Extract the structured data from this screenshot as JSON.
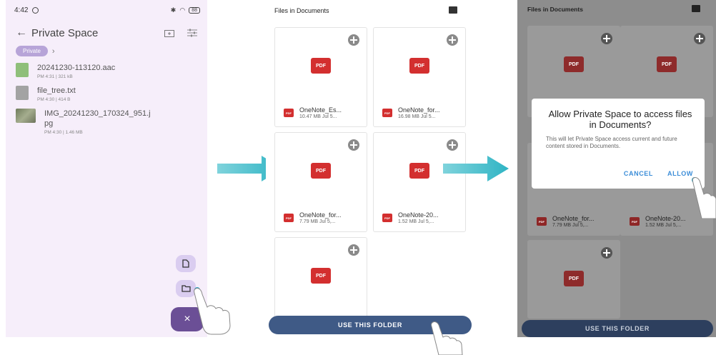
{
  "panel1": {
    "status": {
      "time": "4:42",
      "battery": "88"
    },
    "title": "Private Space",
    "breadcrumb_chip": "Private",
    "files": [
      {
        "name": "20241230-113120.aac",
        "meta": "PM 4:31 | 321 kB",
        "icon": "audio-file-icon",
        "color": "#8fbf7a"
      },
      {
        "name": "file_tree.txt",
        "meta": "PM 4:30 | 414 B",
        "icon": "text-file-icon",
        "color": "#9a9a9a"
      },
      {
        "name": "IMG_20241230_170324_951.j",
        "name2": "pg",
        "meta": "PM 4:30 | 1.46 MB",
        "icon": "image-thumbnail",
        "color": "#7d8a6b"
      }
    ],
    "fab_close": "×"
  },
  "panel2": {
    "header": "Files in Documents",
    "cards": [
      {
        "name": "OneNote_Es...",
        "meta": "10.47 MB Jul 5..."
      },
      {
        "name": "OneNote_for...",
        "meta": "16.98 MB Jul 5..."
      },
      {
        "name": "OneNote_for...",
        "meta": "7.79 MB Jul 5,..."
      },
      {
        "name": "OneNote-20...",
        "meta": "1.52 MB Jul 5,..."
      }
    ],
    "pdf_label": "PDF",
    "use_button": "USE THIS FOLDER"
  },
  "panel3": {
    "header": "Files in Documents",
    "cards": [
      {
        "name": "OneNote_for...",
        "meta": "7.79 MB Jul 5,..."
      },
      {
        "name": "OneNote-20...",
        "meta": "1.52 MB Jul 5,..."
      }
    ],
    "dialog": {
      "title": "Allow Private Space to access files in Documents?",
      "body": "This will let Private Space access current and future content stored in Documents.",
      "cancel": "CANCEL",
      "allow": "ALLOW"
    },
    "use_button": "USE THIS FOLDER"
  },
  "colors": {
    "accent": "#2fb4c4",
    "primary_button": "#3f5a86",
    "fab": "#6b4f96",
    "pdf": "#d32f2f"
  }
}
